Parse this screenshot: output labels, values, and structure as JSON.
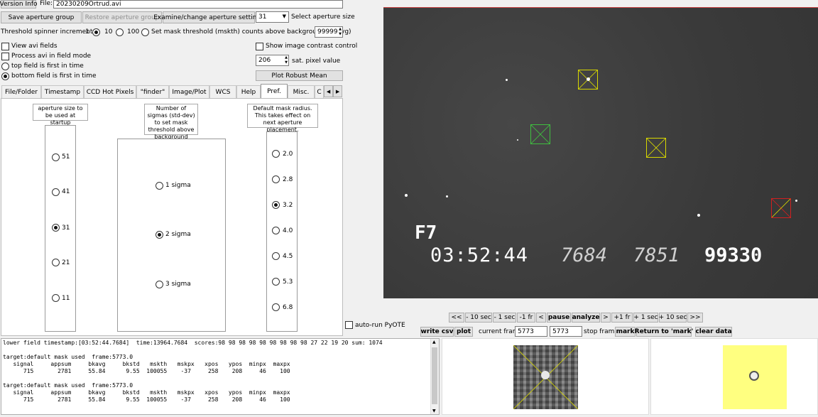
{
  "toolbar": {
    "version_info": "Version Info",
    "file_label": "File:",
    "file_value": "20230209Ortrud.avi",
    "save_aperture": "Save aperture group",
    "restore_aperture": "Restore aperture group",
    "examine_aperture": "Examine/change aperture settings",
    "aperture_size_value": "31",
    "select_aperture_size": "Select aperture size"
  },
  "threshold": {
    "label": "Threshold spinner increments:",
    "opt1": "1",
    "opt10": "10",
    "opt100": "100",
    "set_mask_label": "Set mask threshold (mskth) counts above background (bkavg)",
    "value": "99999"
  },
  "options": {
    "view_avi_fields": "View avi fields",
    "process_field_mode": "Process avi in field mode",
    "top_field_first": "top field is first in time",
    "bottom_field_first": "bottom field is first in time",
    "show_contrast_control": "Show image contrast control",
    "sat_value": "206",
    "sat_label": "sat. pixel value",
    "plot_robust_mean": "Plot Robust Mean"
  },
  "tabs": [
    "File/Folder",
    "Timestamp",
    "CCD Hot Pixels",
    "\"finder\"",
    "Image/Plot",
    "WCS",
    "Help",
    "Pref.",
    "Misc.",
    "C"
  ],
  "pref": {
    "aperture_caption": "aperture size to be used at startup",
    "aperture_options": [
      "51",
      "41",
      "31",
      "21",
      "11"
    ],
    "sigma_caption": "Number of sigmas (std-dev) to set mask threshold above background",
    "sigma_options": [
      "1 sigma",
      "2 sigma",
      "3 sigma"
    ],
    "radius_caption": "Default mask radius. This takes effect on next aperture placement.",
    "radius_options": [
      "2.0",
      "2.8",
      "3.2",
      "4.0",
      "4.5",
      "5.3",
      "6.8"
    ]
  },
  "video": {
    "overlay_line1": "F7",
    "overlay_time": "03:52:44",
    "overlay_n1": "7684",
    "overlay_n2": "7851",
    "overlay_n3": "99330"
  },
  "playback": {
    "buttons": [
      "<<",
      "- 10 sec",
      "- 1 sec",
      "-1 fr",
      "<",
      "pause",
      "analyze",
      ">",
      "+1 fr",
      "+ 1 sec",
      "+ 10 sec",
      ">>"
    ],
    "auto_run": "auto-run PyOTE",
    "write_csv": "write csv",
    "plot": "plot",
    "current_frame_label": "current frame",
    "current_frame_value": "5773",
    "stop_frame_value": "5773",
    "stop_frame_label": "stop frame",
    "mark": "mark",
    "return_mark": "Return to 'mark'",
    "clear_data": "clear data"
  },
  "log": {
    "line1": "lower field timestamp:[03:52:44.7684]  time:13964.7684  scores:98 98 98 98 98 98 98 98 98 27 22 19 20 sum: 1074",
    "line2": "",
    "line3": "target:default mask used  frame:5773.0",
    "line4": "   signal     appsum     bkavg     bkstd   mskth   mskpx   xpos   ypos  minpx  maxpx",
    "line5": "      715       2781     55.84      9.55  100055    -37     258    208     46    100",
    "line6": "",
    "line7": "target:default mask used  frame:5773.0",
    "line8": "   signal     appsum     bkavg     bkstd   mskth   mskpx   xpos   ypos  minpx  maxpx",
    "line9": "      715       2781     55.84      9.55  100055    -37     258    208     46    100"
  },
  "colors": {
    "aperture_yellow": "#d8d800",
    "aperture_green": "#3fbf3f",
    "aperture_red": "#d02020",
    "mask_bg": "#ffff80"
  }
}
